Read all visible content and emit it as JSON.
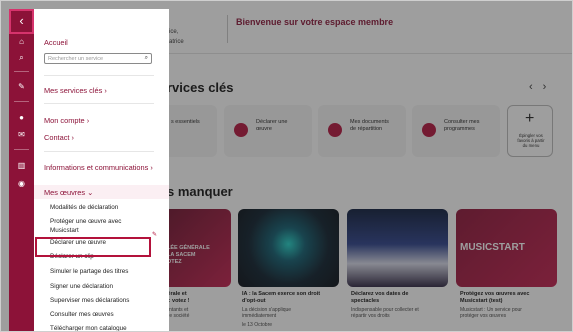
{
  "background": {
    "header_line1": "ice,",
    "header_line2": "atrice",
    "welcome": "Bienvenue sur votre espace membre",
    "section1_title": "rvices clés",
    "arrows": "‹›",
    "cards": [
      {
        "text": "s essentiels",
        "icon": "document-icon"
      },
      {
        "text": "Déclarer une\nœuvre",
        "icon": "document-icon"
      },
      {
        "text": "Mes documents\nde répartition",
        "icon": "folder-icon"
      },
      {
        "text": "Consulter mes\nprogrammes",
        "icon": "mic-icon"
      }
    ],
    "add_card": {
      "plus": "+",
      "text": "Épingler vos\nfavoris à partir\ndu menu"
    },
    "section2_title": "s manquer",
    "news": [
      {
        "title": "énérale et\n24 : votez !",
        "sub": "ésentants et\nvotre société",
        "image_text": "LÉE GÉNÉRALE\nLA SACEM\nOTEZ"
      },
      {
        "title": "IA : la Sacem exerce son droit\nd'opt-out",
        "sub": "La décision s'applique\nimmédiatement",
        "date": "le 13 Octobre"
      },
      {
        "title": "Déclarez vos dates de\nspectacles",
        "sub": "Indispensable pour collecter et\nrépartir vos droits"
      },
      {
        "title": "Protégez vos œuvres avec\nMusicstart (test)",
        "sub": "Musicstart : Un service pour\nprotéger vos œuvres",
        "image_text": "MUSICSTART"
      }
    ]
  },
  "rail": {
    "back_glyph": "‹",
    "icons": [
      "home-icon",
      "search-icon",
      "pin-icon",
      "user-icon",
      "mail-icon",
      "library-icon",
      "music-icon"
    ]
  },
  "menu": {
    "accueil": "Accueil",
    "search_placeholder": "Rechercher un service",
    "services": "Mes services clés",
    "compte": "Mon compte",
    "contact": "Contact",
    "info": "Informations et communications",
    "oeuvres": "Mes œuvres",
    "items": [
      "Modalités de déclaration",
      "Protéger une œuvre avec\nMusicstart",
      "Déclarer une œuvre",
      "Déclarer un clip",
      "Simuler le partage des titres",
      "Signer une déclaration",
      "Superviser mes déclarations",
      "Consulter mes œuvres",
      "Télécharger mon catalogue"
    ]
  },
  "colors": {
    "brand": "#8c1238",
    "highlight": "#b3123b"
  }
}
